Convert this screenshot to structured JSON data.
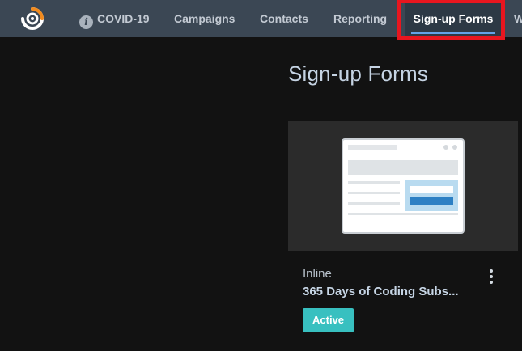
{
  "nav": {
    "covid_label": "COVID-19",
    "campaigns_label": "Campaigns",
    "contacts_label": "Contacts",
    "reporting_label": "Reporting",
    "signup_forms_label": "Sign-up Forms",
    "more_label": "W",
    "active_item": "Sign-up Forms"
  },
  "icons": {
    "logo": "constant-contact-logo-icon",
    "covid_info": "info-icon",
    "card_menu": "kebab-menu-icon",
    "preview": "inline-form-preview-icon"
  },
  "page": {
    "title": "Sign-up Forms"
  },
  "cards": [
    {
      "type_label": "Inline",
      "name": "365 Days of Coding Subs...",
      "status": "Active"
    }
  ],
  "colors": {
    "topbar": "#3b4754",
    "background": "#121212",
    "highlight_box": "#e8161f",
    "active_badge": "#38c0c0",
    "logo_orange": "#f28b1e",
    "active_tab_underline": "#63a2e8"
  }
}
